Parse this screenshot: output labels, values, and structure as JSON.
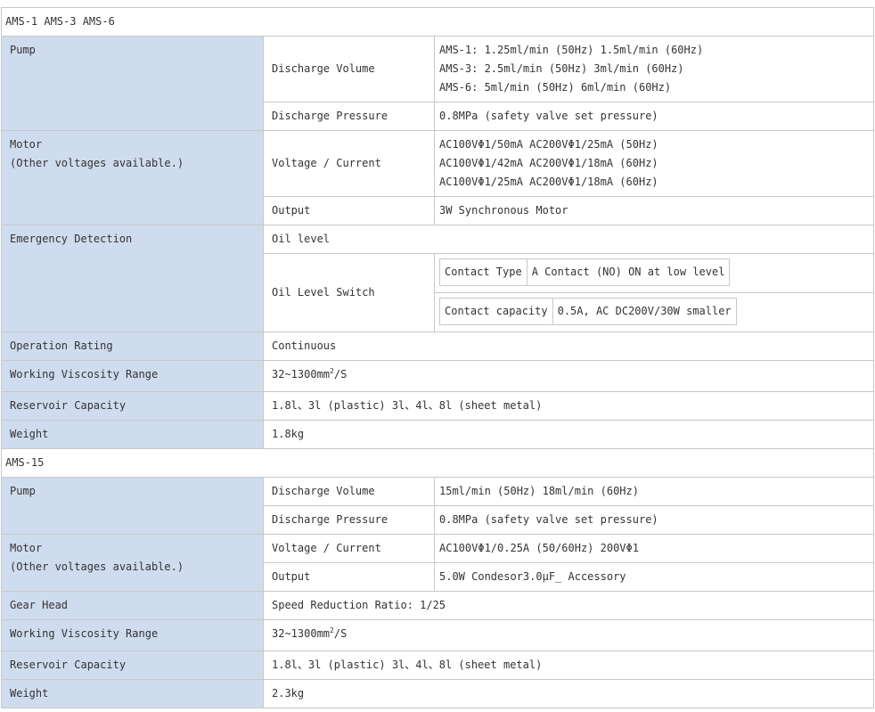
{
  "s1": {
    "title": "AMS-1  AMS-3  AMS-6",
    "pump": "Pump",
    "discharge_volume": "Discharge Volume",
    "dv_lines": [
      "AMS-1: 1.25ml/min (50Hz)  1.5ml/min (60Hz)",
      "AMS-3: 2.5ml/min (50Hz)  3ml/min (60Hz)",
      "AMS-6: 5ml/min (50Hz)  6ml/min (60Hz)"
    ],
    "discharge_pressure": "Discharge Pressure",
    "dp_value": "0.8MPa (safety valve set pressure)",
    "motor": "Motor",
    "motor_note": "(Other voltages available.)",
    "voltage_current": "Voltage / Current",
    "vc_lines": [
      "AC100VΦ1/50mA  AC200VΦ1/25mA (50Hz)",
      "AC100VΦ1/42mA  AC200VΦ1/18mA (60Hz)",
      "AC100VΦ1/25mA  AC200VΦ1/18mA (60Hz)"
    ],
    "output": "Output",
    "output_value": "3W  Synchronous Motor",
    "emergency": "Emergency Detection",
    "oil_level": "Oil level",
    "oil_level_switch": "Oil Level Switch",
    "contact_type_label": "Contact Type",
    "contact_type_value": "A Contact (NO) ON at low level",
    "contact_capacity_label": "Contact capacity",
    "contact_capacity_value": "0.5A, AC DC200V/30W smaller",
    "operation_rating": "Operation Rating",
    "operation_value": "Continuous",
    "viscosity": "Working Viscosity Range",
    "viscosity_value_pre": "32~1300mm",
    "viscosity_sup": "2",
    "viscosity_value_post": "/S",
    "reservoir": "Reservoir Capacity",
    "reservoir_value": "1.8l、3l (plastic)  3l、4l、8l (sheet metal)",
    "weight": "Weight",
    "weight_value": "1.8kg"
  },
  "s2": {
    "title": "AMS-15",
    "pump": "Pump",
    "discharge_volume": "Discharge Volume",
    "dv_value": "15ml/min (50Hz)  18ml/min (60Hz)",
    "discharge_pressure": "Discharge Pressure",
    "dp_value": "0.8MPa (safety valve set pressure)",
    "motor": "Motor",
    "motor_note": "(Other voltages available.)",
    "voltage_current": "Voltage / Current",
    "vc_value": "AC100VΦ1/0.25A (50/60Hz) 200VΦ1",
    "output": "Output",
    "output_value": "5.0W  Condesor3.0μF_ Accessory",
    "gear_head": "Gear Head",
    "gear_value": "Speed Reduction Ratio: 1/25",
    "viscosity": "Working Viscosity Range",
    "viscosity_value_pre": "32~1300mm",
    "viscosity_sup": "2",
    "viscosity_value_post": "/S",
    "reservoir": "Reservoir Capacity",
    "reservoir_value": "1.8l、3l (plastic)  3l、4l、8l (sheet metal)",
    "weight": "Weight",
    "weight_value": "2.3kg"
  }
}
